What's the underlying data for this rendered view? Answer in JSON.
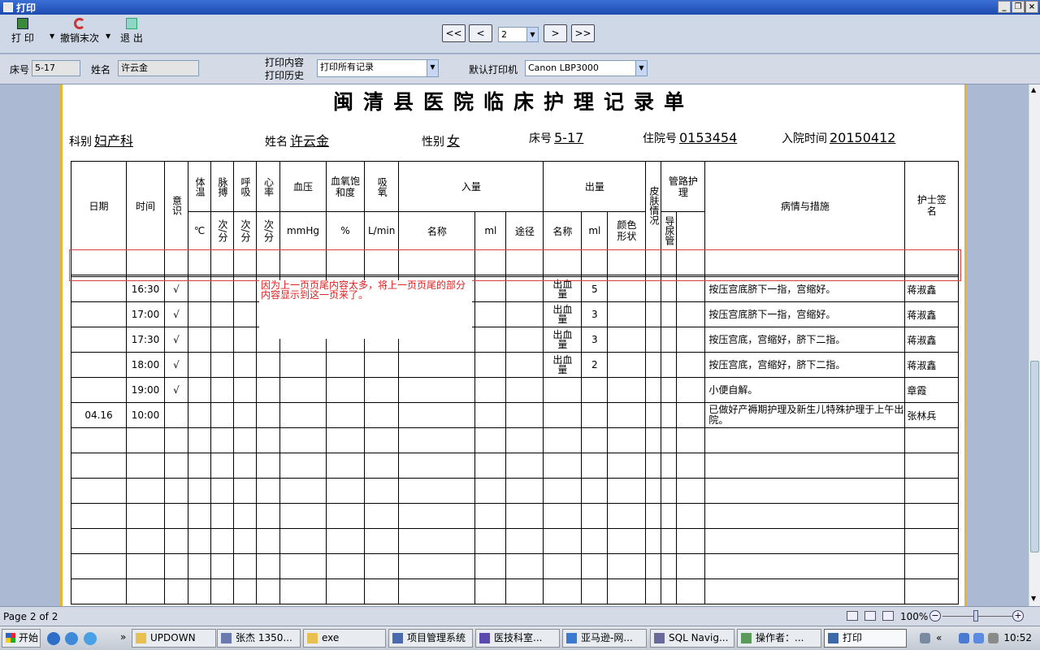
{
  "window": {
    "title": "打印"
  },
  "toolbar": {
    "print_label": "打 印",
    "undo_label": "撤销末次",
    "exit_label": "退 出",
    "nav_first": "<<",
    "nav_prev": "<",
    "nav_next": ">",
    "nav_last": ">>",
    "page_value": "2"
  },
  "infobar": {
    "bed_label": "床号",
    "bed_value": "5-17",
    "name_label": "姓名",
    "name_value": "许云金",
    "print_content_label": "打印内容",
    "print_history_label": "打印历史",
    "print_content_value": "打印所有记录",
    "printer_label": "默认打印机",
    "printer_value": "Canon LBP3000"
  },
  "document": {
    "title": "闽清县医院临床护理记录单",
    "dept_label": "科别",
    "dept_value": "妇产科",
    "name_label": "姓名",
    "name_value": "许云金",
    "sex_label": "性别",
    "sex_value": "女",
    "bed_label": "床号",
    "bed_value": "5-17",
    "admission_no_label": "住院号",
    "admission_no_value": "0153454",
    "admit_time_label": "入院时间",
    "admit_time_value": "20150412",
    "headers": {
      "date": "日期",
      "time": "时间",
      "conscious": "意识",
      "temp": "体温",
      "pulse": "脉搏",
      "resp": "呼吸",
      "heart": "心率",
      "bp": "血压",
      "spo2": "血氧饱和度",
      "oxygen": "吸氧",
      "intake": "入量",
      "output": "出量",
      "skin": "皮肤情况",
      "tube": "管路护理",
      "condition": "病情与措施",
      "nurse": "护士签名",
      "temp_unit": "℃",
      "pulse_unit": "次/分",
      "resp_unit": "次/分",
      "heart_unit": "次/分",
      "bp_unit": "mmHg",
      "spo2_unit": "%",
      "oxygen_unit": "L/min",
      "in_name": "名称",
      "in_ml": "ml",
      "in_route": "途径",
      "out_name": "名称",
      "out_ml": "ml",
      "out_color": "颜色形状",
      "tube_catheter": "导尿管"
    },
    "rows": [
      {
        "date": "",
        "time": "16:30",
        "conscious": "√",
        "out_name": "出血量",
        "out_ml": "5",
        "note": "按压宫底脐下一指，宫缩好。",
        "nurse": "蒋淑鑫"
      },
      {
        "date": "",
        "time": "17:00",
        "conscious": "√",
        "out_name": "出血量",
        "out_ml": "3",
        "note": "按压宫底脐下一指，宫缩好。",
        "nurse": "蒋淑鑫"
      },
      {
        "date": "",
        "time": "17:30",
        "conscious": "√",
        "out_name": "出血量",
        "out_ml": "3",
        "note": "按压宫底，宫缩好，脐下二指。",
        "nurse": "蒋淑鑫"
      },
      {
        "date": "",
        "time": "18:00",
        "conscious": "√",
        "out_name": "出血量",
        "out_ml": "2",
        "note": "按压宫底，宫缩好，脐下二指。",
        "nurse": "蒋淑鑫"
      },
      {
        "date": "",
        "time": "19:00",
        "conscious": "√",
        "out_name": "",
        "out_ml": "",
        "note": "小便自解。",
        "nurse": "章霞"
      },
      {
        "date": "04.16",
        "time": "10:00",
        "conscious": "",
        "out_name": "",
        "out_ml": "",
        "note": "已做好产褥期护理及新生儿特殊护理于上午出院。",
        "nurse": "张林兵"
      }
    ],
    "annotation": "因为上一页页尾内容太多，将上一页页尾的部分内容显示到这一页来了。"
  },
  "status": {
    "page_text": "Page 2 of 2",
    "zoom_text": "100%"
  },
  "taskbar": {
    "start": "开始",
    "tasks": [
      "UPDOWN",
      "张杰 1350...",
      "exe",
      "项目管理系统",
      "医技科室...",
      "亚马逊-网...",
      "SQL Navig...",
      "操作者：...",
      "打印"
    ],
    "clock": "10:52"
  },
  "colors": {
    "accent": "#1d4bb0",
    "annotation": "#e02020",
    "page_border": "#e9b530"
  }
}
